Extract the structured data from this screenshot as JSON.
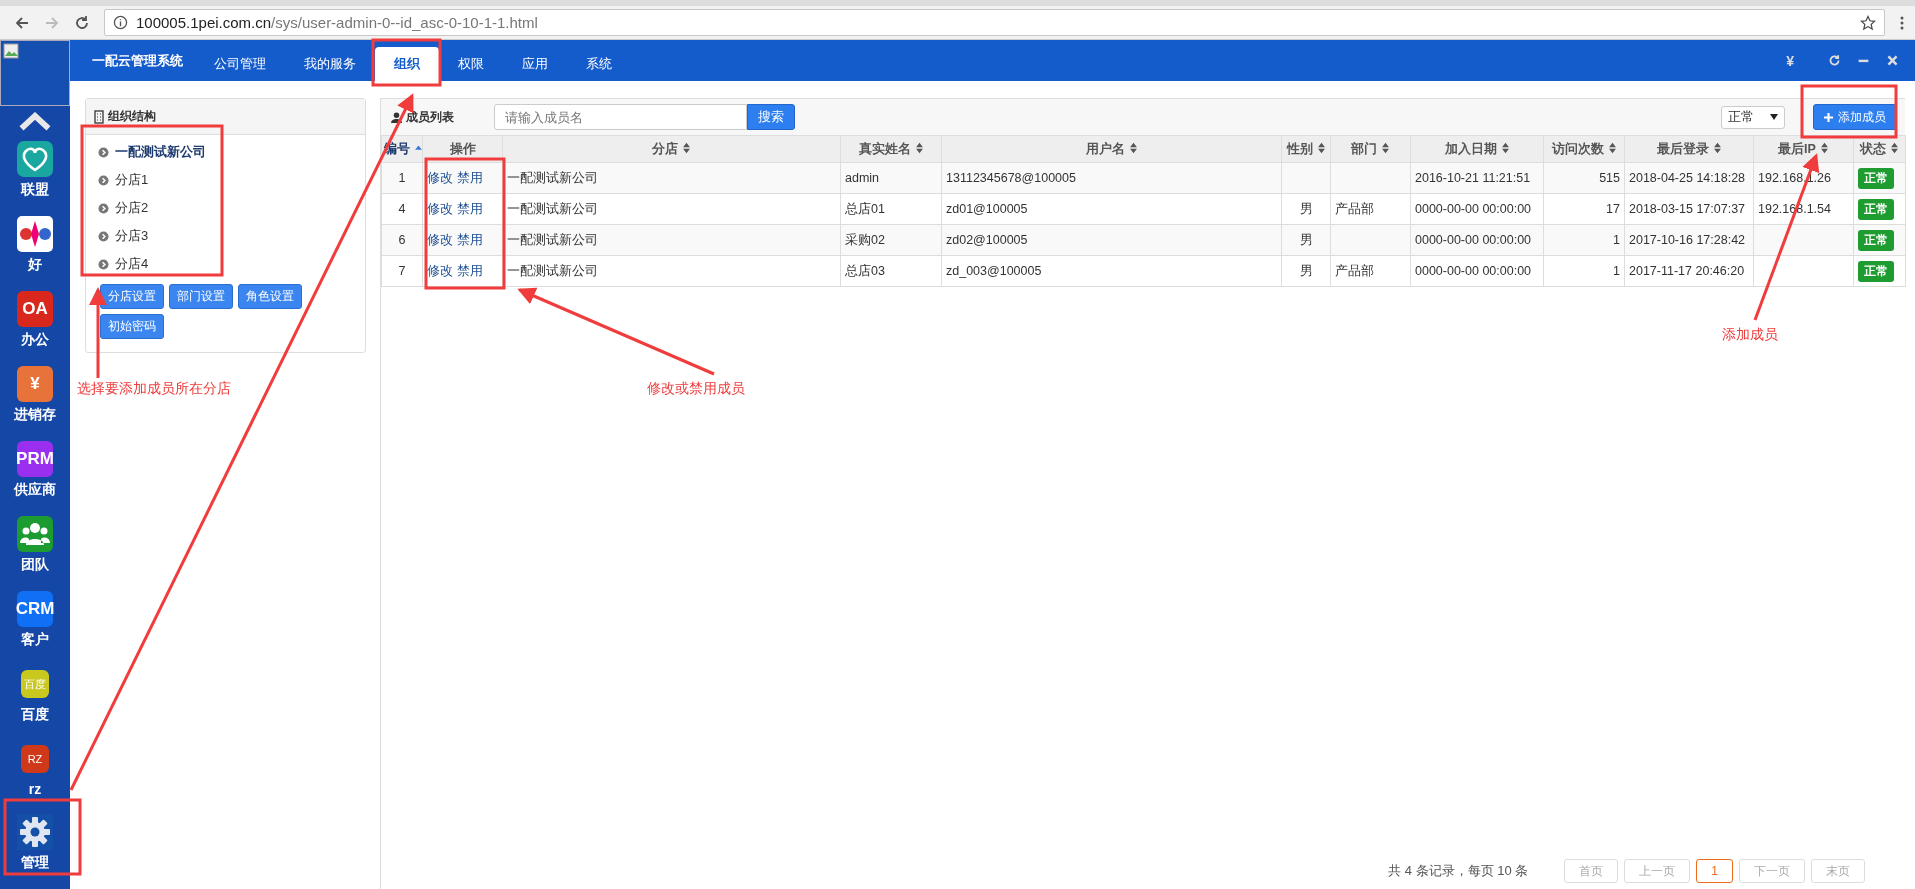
{
  "browser": {
    "url_host": "100005.1pei.com.cn",
    "url_path": "/sys/user-admin-0--id_asc-0-10-1-1.html"
  },
  "nav": {
    "brand": "一配云管理系统",
    "tabs": [
      {
        "label": "公司管理",
        "selected": false
      },
      {
        "label": "我的服务",
        "selected": false
      },
      {
        "label": "组织",
        "selected": true
      },
      {
        "label": "权限",
        "selected": false
      },
      {
        "label": "应用",
        "selected": false
      },
      {
        "label": "系统",
        "selected": false
      }
    ],
    "currency": "¥"
  },
  "sidebar": {
    "apps": [
      {
        "label": "联盟",
        "kind": "heart",
        "color": "#1aa7a0"
      },
      {
        "label": "好",
        "kind": "picture",
        "color": "#ffffff"
      },
      {
        "label": "办公",
        "kind": "text",
        "icon_text": "OA",
        "color": "#d9271e"
      },
      {
        "label": "进销存",
        "kind": "text",
        "icon_text": "¥",
        "color": "#e8733a"
      },
      {
        "label": "供应商",
        "kind": "text",
        "icon_text": "PRM",
        "color": "#9b2ff0"
      },
      {
        "label": "团队",
        "kind": "people",
        "color": "#1b9b30"
      },
      {
        "label": "客户",
        "kind": "text",
        "icon_text": "CRM",
        "color": "#0f6ff5"
      },
      {
        "label": "百度",
        "kind": "text",
        "icon_text": "百度",
        "color": "#c8c81e"
      },
      {
        "label": "rz",
        "kind": "text",
        "icon_text": "RZ",
        "color": "#d0381a"
      },
      {
        "label": "管理",
        "kind": "gear",
        "color": "#1450a8"
      }
    ]
  },
  "org_panel": {
    "title": "组织结构",
    "tree": [
      {
        "label": "一配测试新公司",
        "selected": true
      },
      {
        "label": "分店1",
        "selected": false
      },
      {
        "label": "分店2",
        "selected": false
      },
      {
        "label": "分店3",
        "selected": false
      },
      {
        "label": "分店4",
        "selected": false
      }
    ],
    "buttons": [
      "分店设置",
      "部门设置",
      "角色设置",
      "初始密码"
    ]
  },
  "member_list": {
    "title": "成员列表",
    "search": {
      "placeholder": "请输入成员名"
    },
    "search_button": "搜索",
    "status_filter": "正常",
    "add_button": "添加成员",
    "columns": [
      {
        "label": "编号",
        "sortable": true,
        "sorted_ascending": true
      },
      {
        "label": "操作",
        "sortable": false,
        "sorted_ascending": false
      },
      {
        "label": "分店",
        "sortable": true,
        "sorted_ascending": false
      },
      {
        "label": "真实姓名",
        "sortable": true,
        "sorted_ascending": false
      },
      {
        "label": "用户名",
        "sortable": true,
        "sorted_ascending": false
      },
      {
        "label": "性别",
        "sortable": true,
        "sorted_ascending": false
      },
      {
        "label": "部门",
        "sortable": true,
        "sorted_ascending": false
      },
      {
        "label": "加入日期",
        "sortable": true,
        "sorted_ascending": false
      },
      {
        "label": "访问次数",
        "sortable": true,
        "sorted_ascending": false
      },
      {
        "label": "最后登录",
        "sortable": true,
        "sorted_ascending": false
      },
      {
        "label": "最后IP",
        "sortable": true,
        "sorted_ascending": false
      },
      {
        "label": "状态",
        "sortable": true,
        "sorted_ascending": false
      }
    ],
    "rows": [
      {
        "id": "1",
        "actions": [
          "修改",
          "禁用"
        ],
        "branch": "一配测试新公司",
        "real_name": "admin",
        "username": "13112345678@100005",
        "gender": "",
        "department": "",
        "joined": "2016-10-21 11:21:51",
        "visits": "515",
        "last_login": "2018-04-25 14:18:28",
        "last_ip": "192.168.1.26",
        "status": "正常"
      },
      {
        "id": "4",
        "actions": [
          "修改",
          "禁用"
        ],
        "branch": "一配测试新公司",
        "real_name": "总店01",
        "username": "zd01@100005",
        "gender": "男",
        "department": "产品部",
        "joined": "0000-00-00 00:00:00",
        "visits": "17",
        "last_login": "2018-03-15 17:07:37",
        "last_ip": "192.168.1.54",
        "status": "正常"
      },
      {
        "id": "6",
        "actions": [
          "修改",
          "禁用"
        ],
        "branch": "一配测试新公司",
        "real_name": "采购02",
        "username": "zd02@100005",
        "gender": "男",
        "department": "",
        "joined": "0000-00-00 00:00:00",
        "visits": "1",
        "last_login": "2017-10-16 17:28:42",
        "last_ip": "",
        "status": "正常"
      },
      {
        "id": "7",
        "actions": [
          "修改",
          "禁用"
        ],
        "branch": "一配测试新公司",
        "real_name": "总店03",
        "username": "zd_003@100005",
        "gender": "男",
        "department": "产品部",
        "joined": "0000-00-00 00:00:00",
        "visits": "1",
        "last_login": "2017-11-17 20:46:20",
        "last_ip": "",
        "status": "正常"
      }
    ],
    "pagination": {
      "summary": "共 4 条记录，每页 10 条",
      "pages": [
        {
          "label": "首页",
          "selected": false
        },
        {
          "label": "上一页",
          "selected": false
        },
        {
          "label": "1",
          "selected": true
        },
        {
          "label": "下一页",
          "selected": false
        },
        {
          "label": "末页",
          "selected": false
        }
      ]
    }
  },
  "annotations": [
    "选择要添加成员所在分店",
    "修改或禁用成员",
    "添加成员"
  ]
}
